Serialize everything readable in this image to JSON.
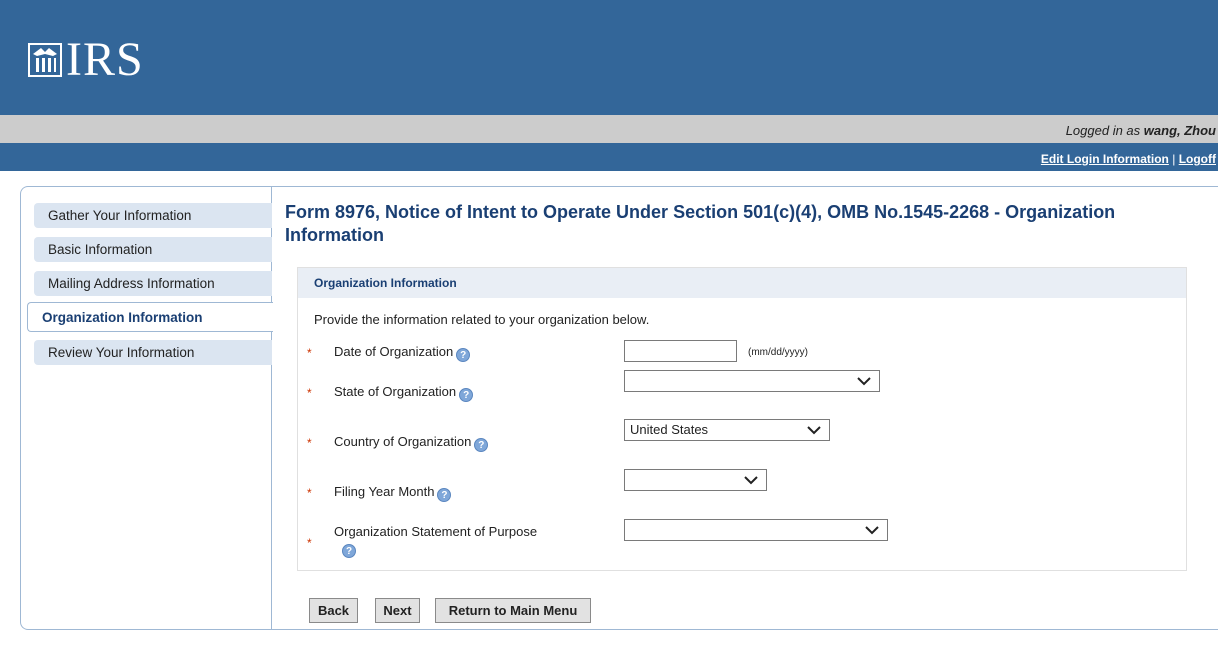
{
  "header": {
    "logo_text": "IRS",
    "logo_icon": "irs-eagle-icon"
  },
  "login": {
    "prefix": "Logged in as",
    "user": "wang, Zhou"
  },
  "links": {
    "edit_login": "Edit Login Information",
    "separator": "|",
    "logoff": "Logoff"
  },
  "sidebar": {
    "items": [
      {
        "label": "Gather Your Information"
      },
      {
        "label": "Basic Information"
      },
      {
        "label": "Mailing Address Information"
      },
      {
        "label": "Organization Information"
      },
      {
        "label": "Review Your Information"
      }
    ],
    "active_index": 3
  },
  "page": {
    "title": "Form 8976, Notice of Intent to Operate Under Section 501(c)(4), OMB No.1545-2268 - Organization Information"
  },
  "panel": {
    "heading": "Organization Information",
    "intro": "Provide the information related to your organization below.",
    "required_marker": "*",
    "help_glyph": "?",
    "fields": {
      "date": {
        "label": "Date of Organization",
        "value": "",
        "hint": "(mm/dd/yyyy)"
      },
      "state": {
        "label": "State of Organization",
        "value": ""
      },
      "country": {
        "label": "Country of Organization",
        "value": "United States"
      },
      "filing": {
        "label": "Filing Year Month",
        "value": ""
      },
      "purpose": {
        "label": "Organization Statement of Purpose",
        "value": ""
      }
    }
  },
  "buttons": {
    "back": "Back",
    "next": "Next",
    "main_menu": "Return to Main Menu"
  },
  "colors": {
    "brand_blue": "#336699",
    "nav_bg": "#dbe5f1",
    "title": "#1a3f73",
    "required": "#cc3300"
  }
}
